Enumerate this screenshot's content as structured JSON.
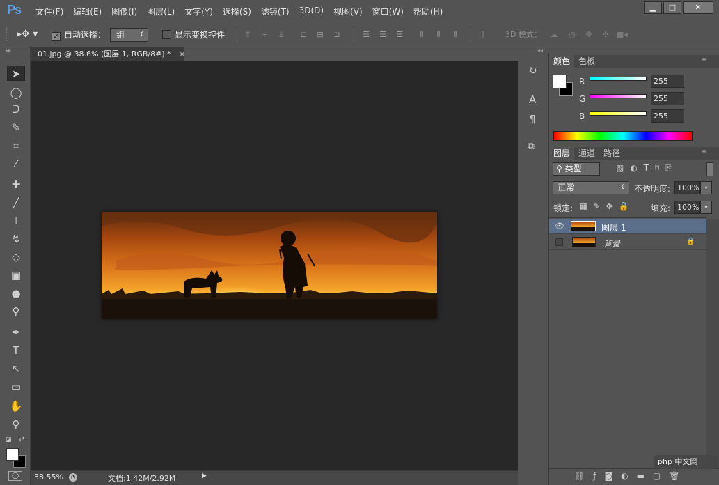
{
  "app": {
    "logo": "Ps"
  },
  "menu": [
    "文件(F)",
    "编辑(E)",
    "图像(I)",
    "图层(L)",
    "文字(Y)",
    "选择(S)",
    "滤镜(T)",
    "3D(D)",
    "视图(V)",
    "窗口(W)",
    "帮助(H)"
  ],
  "window_controls": {
    "minimize": "▁",
    "maximize": "□",
    "close": "✕"
  },
  "options": {
    "auto_select_label": "自动选择：",
    "auto_select_checked": true,
    "group_value": "组",
    "show_transform_label": "显示变换控件",
    "show_transform_checked": false,
    "mode3d_label": "3D 模式："
  },
  "document": {
    "tab_title": "01.jpg @ 38.6% (图层 1, RGB/8#) *",
    "tab_close": "×"
  },
  "status": {
    "zoom": "38.55%",
    "doc_info": "文档:1.42M/2.92M"
  },
  "color_panel": {
    "tabs": [
      "颜色",
      "色板"
    ],
    "channels": [
      {
        "label": "R",
        "value": "255"
      },
      {
        "label": "G",
        "value": "255"
      },
      {
        "label": "B",
        "value": "255"
      }
    ]
  },
  "layers_panel": {
    "tabs": [
      "图层",
      "通道",
      "路径"
    ],
    "filter_kind": "类型",
    "blend_mode": "正常",
    "opacity_label": "不透明度:",
    "opacity_value": "100%",
    "lock_label": "锁定:",
    "fill_label": "填充:",
    "fill_value": "100%",
    "layers": [
      {
        "name": "图层 1",
        "selected": true,
        "visible": true,
        "locked": false
      },
      {
        "name": "背景",
        "selected": false,
        "visible": false,
        "locked": true
      }
    ]
  },
  "watermark": {
    "text": "php 中文网"
  },
  "colors": {
    "accent": "#5aa0e6",
    "selected_layer": "#5b6e8a"
  }
}
